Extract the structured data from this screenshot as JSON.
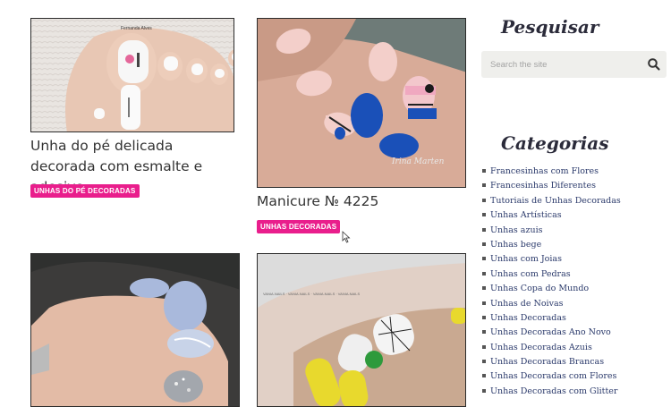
{
  "posts": [
    {
      "title": "Unha do pé delicada decorada com esmalte e adesivo",
      "category": "UNHAS DO PÉ DECORADAS",
      "image_caption": "Fernanda Alves"
    },
    {
      "title": "Manicure № 4225",
      "category": "UNHAS DECORADAS",
      "image_caption": "Irina Marten"
    },
    {
      "title": "",
      "category": "",
      "image_caption": ""
    },
    {
      "title": "",
      "category": "",
      "image_caption": ""
    }
  ],
  "sidebar": {
    "search": {
      "title": "Pesquisar",
      "placeholder": "Search the site",
      "icon": "search-icon"
    },
    "categories": {
      "title": "Categorias",
      "items": [
        "Francesinhas com Flores",
        "Francesinhas Diferentes",
        "Tutoriais de Unhas Decoradas",
        "Unhas Artísticas",
        "Unhas azuis",
        "Unhas bege",
        "Unhas com Joias",
        "Unhas com Pedras",
        "Unhas Copa do Mundo",
        "Unhas de Noivas",
        "Unhas Decoradas",
        "Unhas Decoradas Ano Novo",
        "Unhas Decoradas Azuis",
        "Unhas Decoradas Brancas",
        "Unhas Decoradas com Flores",
        "Unhas Decoradas com Glitter"
      ]
    }
  },
  "colors": {
    "tag": "#e91e8c",
    "link": "#2b3a6b",
    "search_bg": "#efefec"
  }
}
